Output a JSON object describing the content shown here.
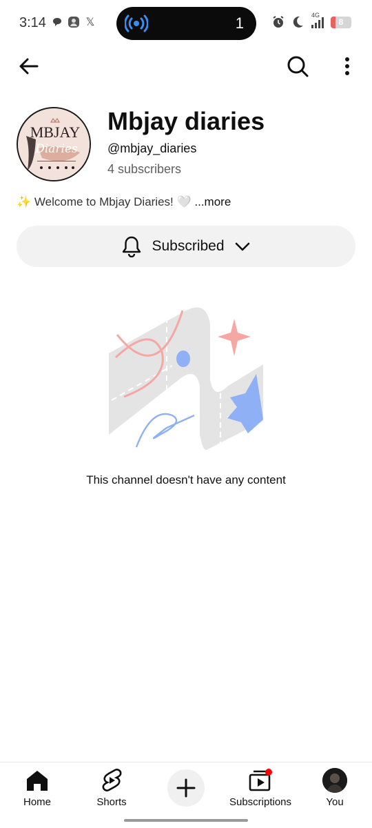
{
  "status_bar": {
    "time": "3:14",
    "left_icons": [
      "chat-bubble-icon",
      "contact-icon",
      "x-logo-icon"
    ],
    "x_logo_glyph": "𝕏",
    "island_count": "1",
    "network_label": "4G",
    "battery_level": "8",
    "battery_fraction": 0.08,
    "battery_color": "#e8615f"
  },
  "top_bar": {
    "back_icon": "arrow-left-icon",
    "search_icon": "search-icon",
    "more_icon": "more-vertical-icon"
  },
  "channel": {
    "logo_text_main": "MBJAY",
    "logo_text_script": "Diaries",
    "name": "Mbjay diaries",
    "handle": "@mbjay_diaries",
    "subscribers": "4 subscribers",
    "description_emoji": "✨",
    "description": "Welcome to Mbjay Diaries! 🤍",
    "more_label": "...more"
  },
  "subscribe": {
    "label": "Subscribed",
    "icon": "bell-icon",
    "chevron": "chevron-down-icon"
  },
  "empty_state": {
    "message": "This channel doesn't have any content"
  },
  "bottom_nav": {
    "items": [
      {
        "label": "Home",
        "icon": "home-icon"
      },
      {
        "label": "Shorts",
        "icon": "shorts-icon"
      },
      {
        "label": "",
        "icon": "plus-icon"
      },
      {
        "label": "Subscriptions",
        "icon": "subscriptions-icon"
      },
      {
        "label": "You",
        "icon": "avatar"
      }
    ]
  },
  "colors": {
    "accent_red": "#ff0000",
    "illustration_pink": "#f4a7a3",
    "illustration_blue": "#8fb0f5"
  }
}
